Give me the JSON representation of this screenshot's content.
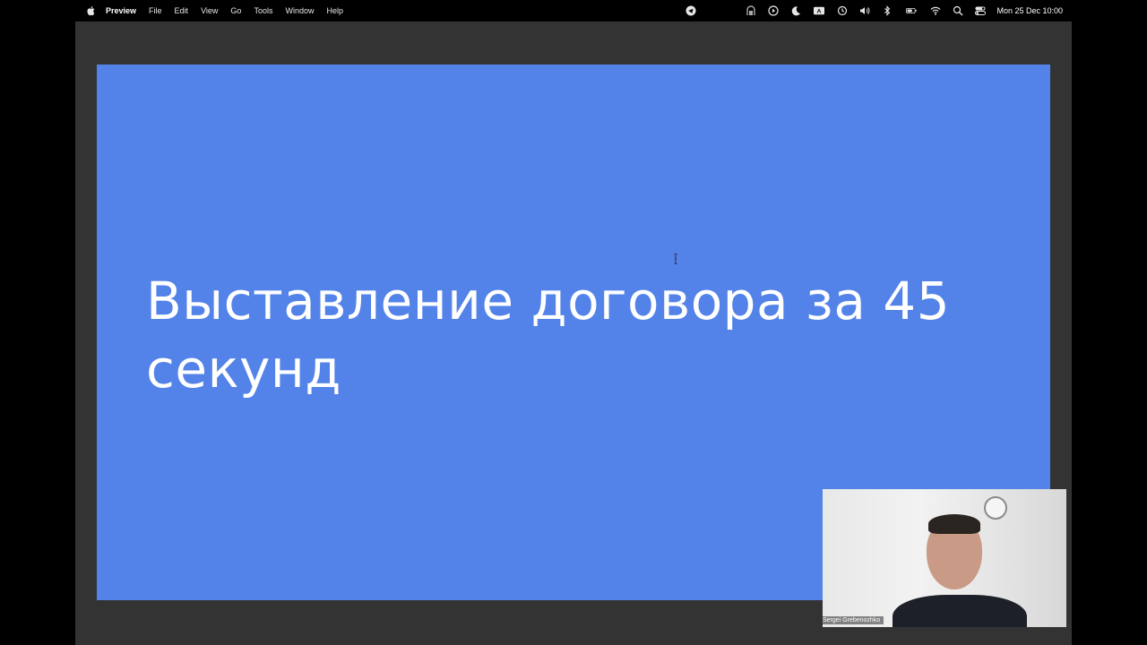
{
  "menubar": {
    "app_name": "Preview",
    "items": [
      "File",
      "Edit",
      "View",
      "Go",
      "Tools",
      "Window",
      "Help"
    ],
    "datetime": "Mon 25 Dec  10:00"
  },
  "status_icons": [
    "telegram-icon",
    "screen-record-icon",
    "play-icon",
    "moon-icon",
    "keyboard-input-icon",
    "time-machine-icon",
    "volume-icon",
    "bluetooth-icon",
    "battery-icon",
    "wifi-icon",
    "spotlight-search-icon",
    "control-center-icon"
  ],
  "slide": {
    "title": "Выставление договора за 45 секунд",
    "background": "#5383e8"
  },
  "video": {
    "participant_name": "Sergei Grebenozhko"
  }
}
